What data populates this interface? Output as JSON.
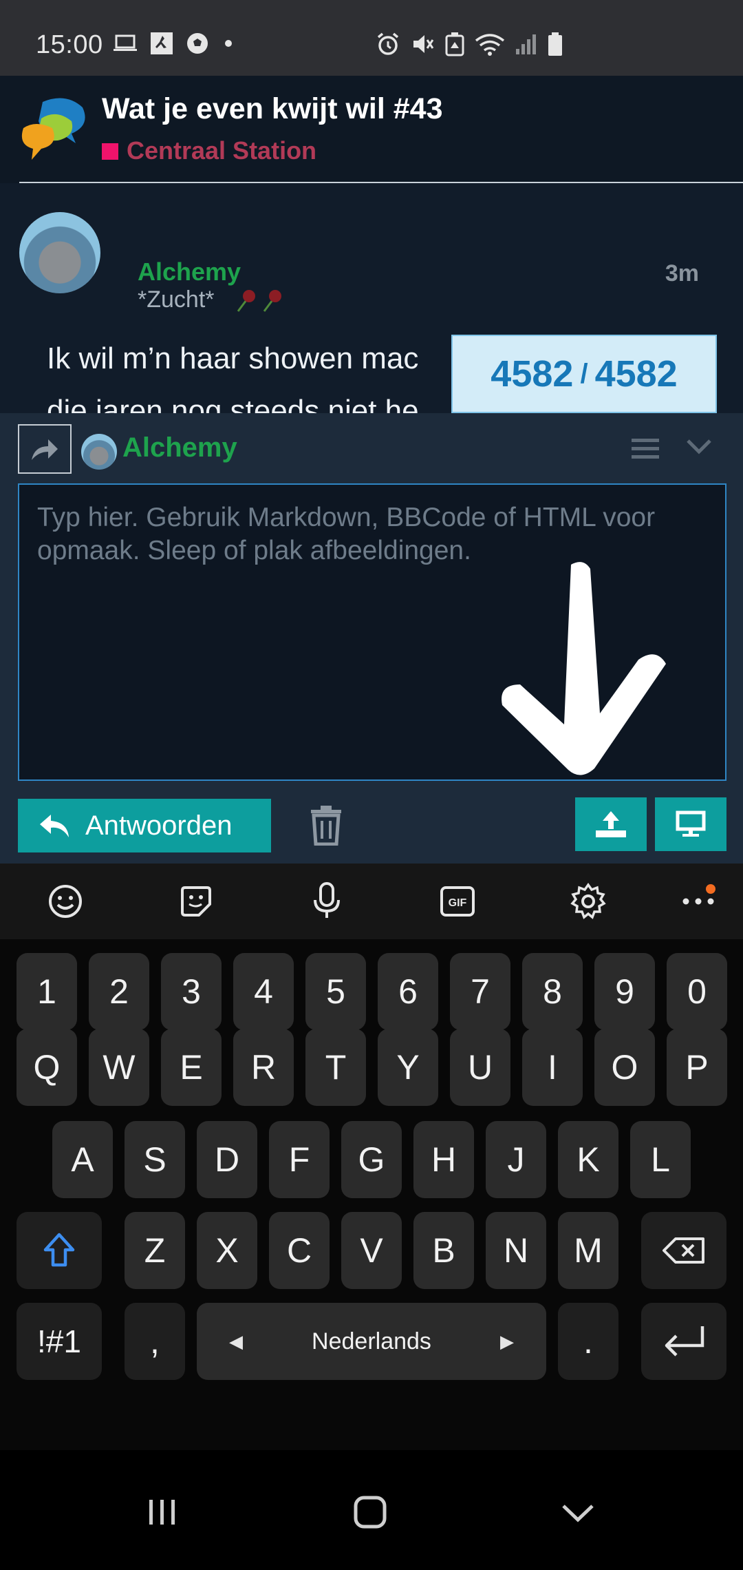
{
  "status_bar": {
    "time": "15:00",
    "left_icons": [
      "laptop-icon",
      "jordan-icon",
      "soccer-ball-icon",
      "dot-icon"
    ],
    "right_icons": [
      "alarm-icon",
      "mute-icon",
      "recycle-icon",
      "wifi-icon",
      "signal-icon",
      "battery-icon"
    ]
  },
  "header": {
    "topic_title": "Wat je even kwijt wil #43",
    "category": "Centraal Station",
    "category_color": "#f0136b"
  },
  "post": {
    "username": "Alchemy",
    "user_title": "*Zucht*",
    "age": "3m",
    "text_line1": "Ik wil m’n haar showen mac",
    "text_line2": "die jaren nog steeds niet he"
  },
  "progress": {
    "current": "4582",
    "separator": "/",
    "total": "4582"
  },
  "composer": {
    "reply_username": "Alchemy",
    "placeholder": "Typ hier. Gebruik Markdown, BBCode of HTML voor opmaak. Sleep of plak afbeeldingen.",
    "value": "",
    "reply_button_label": "Antwoorden"
  },
  "keyboard": {
    "toolbar_icons": [
      "emoji-icon",
      "sticker-icon",
      "microphone-icon",
      "gif-icon",
      "settings-icon",
      "more-icon"
    ],
    "row_numbers": [
      "1",
      "2",
      "3",
      "4",
      "5",
      "6",
      "7",
      "8",
      "9",
      "0"
    ],
    "row_1": [
      "Q",
      "W",
      "E",
      "R",
      "T",
      "Y",
      "U",
      "I",
      "O",
      "P"
    ],
    "row_2": [
      "A",
      "S",
      "D",
      "F",
      "G",
      "H",
      "J",
      "K",
      "L"
    ],
    "row_3": [
      "Z",
      "X",
      "C",
      "V",
      "B",
      "N",
      "M"
    ],
    "symbols_key": "!#1",
    "comma_key": ",",
    "space_language": "Nederlands",
    "period_key": "."
  },
  "nav_bar": {
    "items": [
      "recent-apps-icon",
      "home-icon",
      "back-icon"
    ]
  },
  "colors": {
    "accent_teal": "#0d9e9e",
    "username_green": "#1ea34d",
    "progress_blue": "#1778b8"
  }
}
